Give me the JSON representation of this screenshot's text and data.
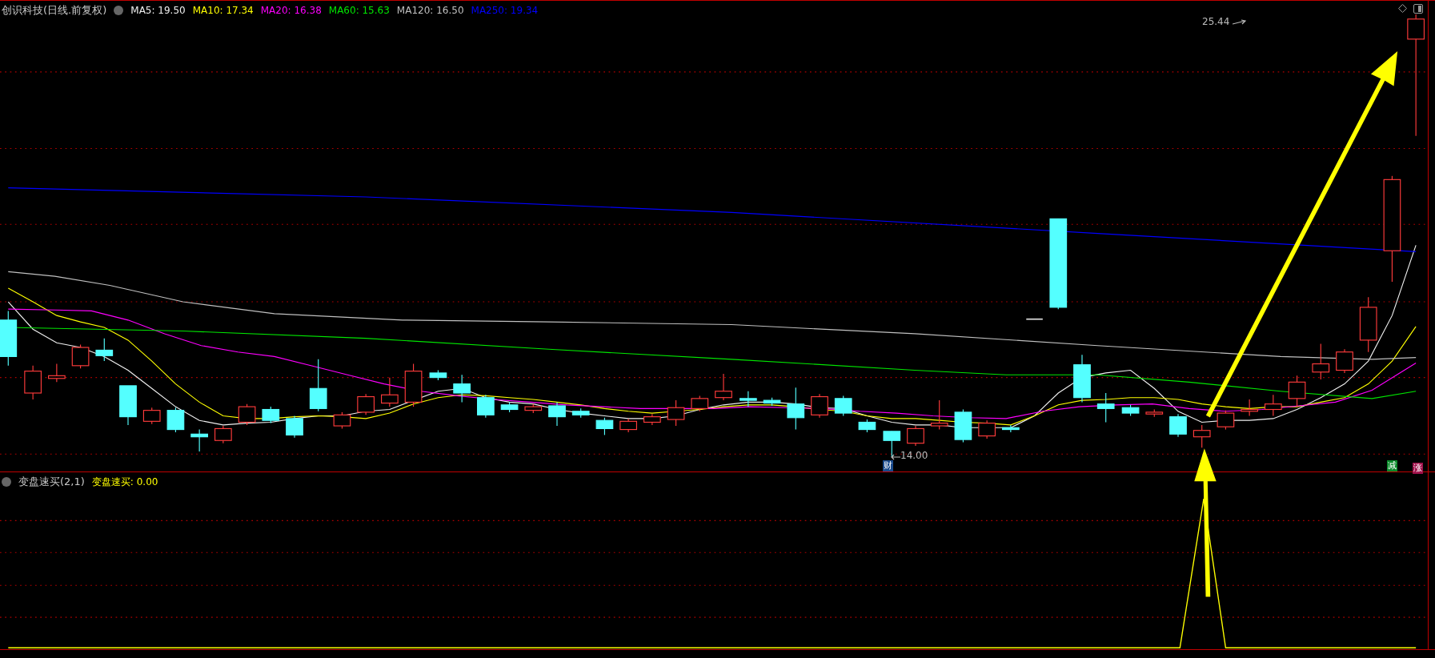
{
  "main_chart": {
    "title": "创识科技(日线.前复权)",
    "ma_legend": [
      {
        "label": "MA5: 19.50",
        "color": "#f0f0f0"
      },
      {
        "label": "MA10: 17.34",
        "color": "#ffff00"
      },
      {
        "label": "MA20: 16.38",
        "color": "#ff00ff"
      },
      {
        "label": "MA60: 15.63",
        "color": "#00e600"
      },
      {
        "label": "MA120: 16.50",
        "color": "#c0c0c0"
      },
      {
        "label": "MA250: 19.34",
        "color": "#0000ff"
      }
    ],
    "price_labels": [
      {
        "kind": "high",
        "text": "25.44"
      },
      {
        "kind": "low",
        "text": "14.00"
      }
    ],
    "badges": [
      {
        "text": "财",
        "color": "#1a4a8c"
      },
      {
        "text": "减",
        "color": "#0a8a2a"
      },
      {
        "text": "涨",
        "color": "#a0104a"
      }
    ]
  },
  "indicator": {
    "title": "变盘速买(2,1)",
    "readout": "变盘速买: 0.00"
  }
}
